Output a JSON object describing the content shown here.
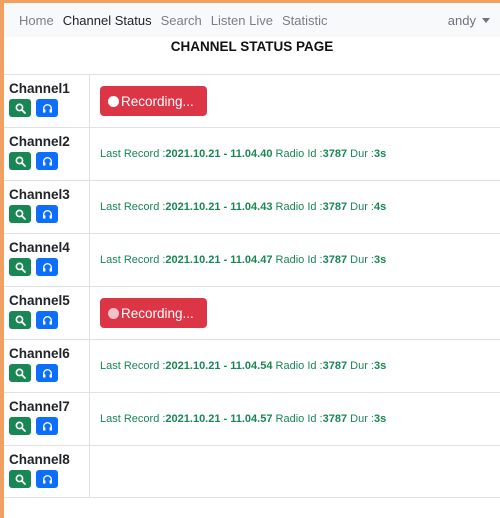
{
  "navbar": {
    "links": [
      "Home",
      "Channel Status",
      "Search",
      "Listen Live",
      "Statistic"
    ],
    "active": "Channel Status",
    "user": "andy"
  },
  "page": {
    "title": "CHANNEL STATUS PAGE"
  },
  "labels": {
    "last_record": "Last Record :",
    "radio_id": " Radio Id :",
    "dur": " Dur :",
    "recording": "Recording..."
  },
  "colors": {
    "search": "#198754",
    "listen": "#0d6efd",
    "recording": "#dc3545",
    "text_green": "#198754"
  },
  "icons": {
    "search": "search-icon",
    "listen": "headphones-icon",
    "caret": "caret-down-icon"
  },
  "channels": [
    {
      "name": "Channel1",
      "status": "recording"
    },
    {
      "name": "Channel2",
      "status": "last",
      "date": "2021.10.21 - 11.04.40",
      "radio_id": "3787",
      "dur": "3s"
    },
    {
      "name": "Channel3",
      "status": "last",
      "date": "2021.10.21 - 11.04.43",
      "radio_id": "3787",
      "dur": "4s"
    },
    {
      "name": "Channel4",
      "status": "last",
      "date": "2021.10.21 - 11.04.47",
      "radio_id": "3787",
      "dur": "3s"
    },
    {
      "name": "Channel5",
      "status": "recording"
    },
    {
      "name": "Channel6",
      "status": "last",
      "date": "2021.10.21 - 11.04.54",
      "radio_id": "3787",
      "dur": "3s"
    },
    {
      "name": "Channel7",
      "status": "last",
      "date": "2021.10.21 - 11.04.57",
      "radio_id": "3787",
      "dur": "3s"
    },
    {
      "name": "Channel8",
      "status": "empty"
    }
  ]
}
